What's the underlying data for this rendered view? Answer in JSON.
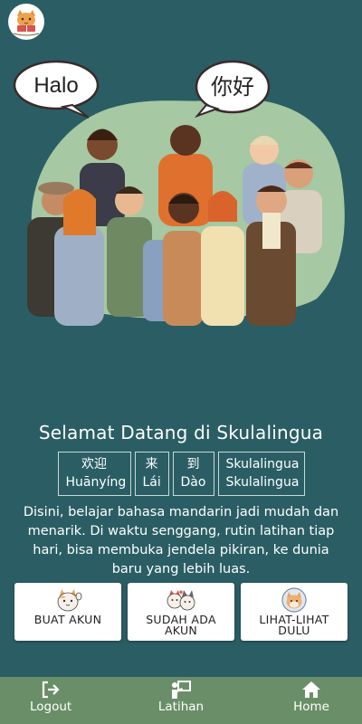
{
  "app": {
    "logo_icon": "cat-reading-logo-icon"
  },
  "hero": {
    "bubble_left": "Halo",
    "bubble_right": "你好"
  },
  "welcome": {
    "title": "Selamat Datang di Skulalingua",
    "words": [
      {
        "hanzi": "欢迎",
        "pinyin": "Huānyíng"
      },
      {
        "hanzi": "来",
        "pinyin": "Lái"
      },
      {
        "hanzi": "到",
        "pinyin": "Dào"
      },
      {
        "hanzi": "Skulalingua",
        "pinyin": "Skulalingua"
      }
    ],
    "description": "Disini, belajar bahasa mandarin jadi mudah dan menarik. Di waktu senggang, rutin latihan tiap hari, bisa membuka jendela pikiran, ke dunia baru yang lebih luas."
  },
  "actions": [
    {
      "label": "BUAT AKUN",
      "icon": "cat-waving-icon"
    },
    {
      "label": "SUDAH ADA AKUN",
      "icon": "cats-together-icon"
    },
    {
      "label": "LIHAT-LIHAT DULU",
      "icon": "cat-astronaut-icon"
    }
  ],
  "nav": {
    "logout": "Logout",
    "latihan": "Latihan",
    "home": "Home"
  },
  "colors": {
    "background": "#2a5e64",
    "nav_bar": "#6a8f68",
    "blob": "#a6c8a2"
  }
}
